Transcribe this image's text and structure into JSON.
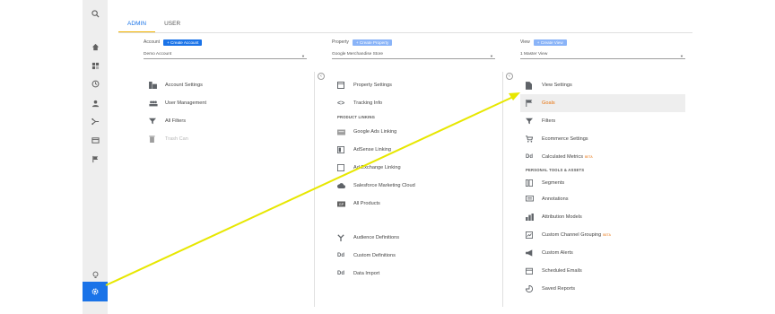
{
  "tabs": [
    {
      "label": "ADMIN",
      "active": true
    },
    {
      "label": "USER",
      "active": false
    }
  ],
  "account": {
    "header": "Account",
    "create_label": "+ Create Account",
    "selected": "Demo Account",
    "items": [
      {
        "label": "Account Settings",
        "icon": "building-icon"
      },
      {
        "label": "User Management",
        "icon": "people-icon"
      },
      {
        "label": "All Filters",
        "icon": "filter-icon"
      },
      {
        "label": "Trash Can",
        "icon": "trash-icon",
        "muted": true
      }
    ]
  },
  "property": {
    "header": "Property",
    "create_label": "+ Create Property",
    "selected": "Google Merchandise Store",
    "items": [
      {
        "label": "Property Settings",
        "icon": "square-icon"
      },
      {
        "label": "Tracking Info",
        "icon": "code-icon"
      }
    ],
    "product_linking_header": "PRODUCT LINKING",
    "linking_items": [
      {
        "label": "Google Ads Linking",
        "icon": "ads-icon"
      },
      {
        "label": "AdSense Linking",
        "icon": "adsense-icon"
      },
      {
        "label": "Ad Exchange Linking",
        "icon": "adx-icon"
      },
      {
        "label": "Salesforce Marketing Cloud",
        "icon": "cloud-icon"
      },
      {
        "label": "All Products",
        "icon": "grid-icon"
      }
    ],
    "more_items": [
      {
        "label": "Audience Definitions",
        "icon": "fork-icon"
      },
      {
        "label": "Custom Definitions",
        "icon": "dd-icon"
      },
      {
        "label": "Data Import",
        "icon": "dd-icon"
      }
    ]
  },
  "view": {
    "header": "View",
    "create_label": "+ Create View",
    "selected": "1 Master View",
    "items": [
      {
        "label": "View Settings",
        "icon": "doc-icon"
      },
      {
        "label": "Goals",
        "icon": "flag-icon"
      },
      {
        "label": "Filters",
        "icon": "filter-icon"
      },
      {
        "label": "Ecommerce Settings",
        "icon": "cart-icon"
      },
      {
        "label": "Calculated Metrics",
        "icon": "dd-icon",
        "badge": "BETA"
      }
    ],
    "personal_header": "PERSONAL TOOLS & ASSETS",
    "personal_items": [
      {
        "label": "Segments",
        "icon": "segment-icon"
      },
      {
        "label": "Annotations",
        "icon": "comment-icon"
      },
      {
        "label": "Attribution Models",
        "icon": "bars-icon"
      },
      {
        "label": "Custom Channel Grouping",
        "icon": "channel-icon",
        "badge": "BETA"
      },
      {
        "label": "Custom Alerts",
        "icon": "megaphone-icon"
      },
      {
        "label": "Scheduled Emails",
        "icon": "calendar-icon"
      },
      {
        "label": "Saved Reports",
        "icon": "report-icon"
      }
    ]
  },
  "colors": {
    "accent": "#1a73e8",
    "tab_underline": "#f4b400",
    "highlight_text": "#e8710a",
    "annotation_arrow": "#f0f000"
  }
}
